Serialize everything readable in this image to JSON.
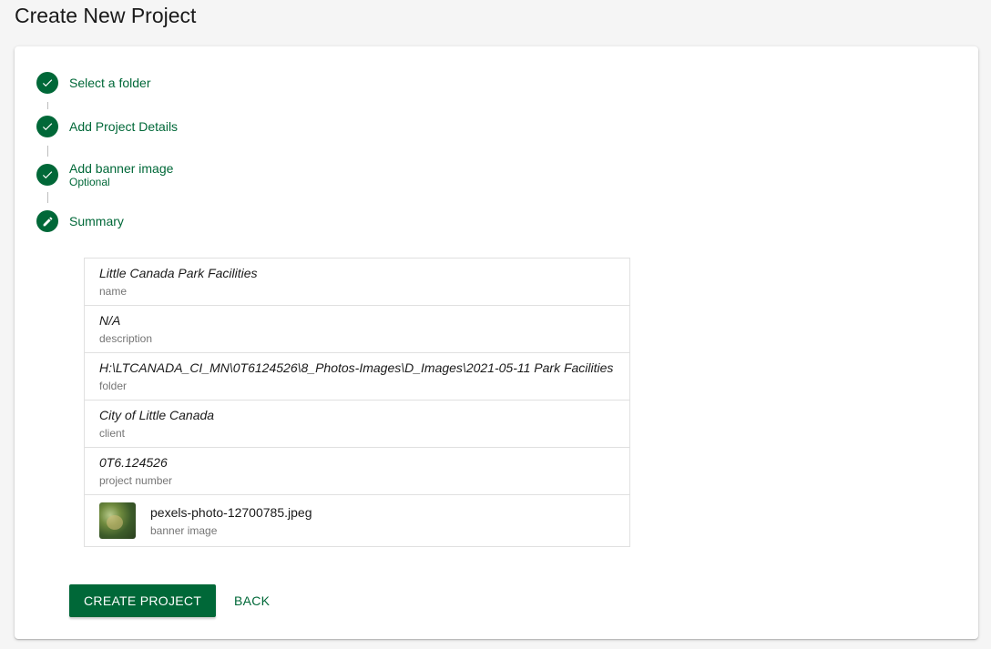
{
  "page": {
    "title": "Create New Project"
  },
  "stepper": {
    "steps": [
      {
        "label": "Select a folder",
        "optional": "",
        "icon": "check-icon"
      },
      {
        "label": "Add Project Details",
        "optional": "",
        "icon": "check-icon"
      },
      {
        "label": "Add banner image",
        "optional": "Optional",
        "icon": "check-icon"
      },
      {
        "label": "Summary",
        "optional": "",
        "icon": "pencil-icon"
      }
    ]
  },
  "summary": {
    "rows": [
      {
        "value": "Little Canada Park Facilities",
        "key": "name"
      },
      {
        "value": "N/A",
        "key": "description"
      },
      {
        "value": "H:\\LTCANADA_CI_MN\\0T6124526\\8_Photos-Images\\D_Images\\2021-05-11 Park Facilities",
        "key": "folder"
      },
      {
        "value": "City of Little Canada",
        "key": "client"
      },
      {
        "value": "0T6.124526",
        "key": "project number"
      }
    ],
    "banner": {
      "filename": "pexels-photo-12700785.jpeg",
      "key": "banner image"
    }
  },
  "actions": {
    "create_label": "CREATE PROJECT",
    "back_label": "BACK"
  },
  "colors": {
    "accent": "#006838",
    "background": "#f5f5f5",
    "card": "#ffffff"
  }
}
